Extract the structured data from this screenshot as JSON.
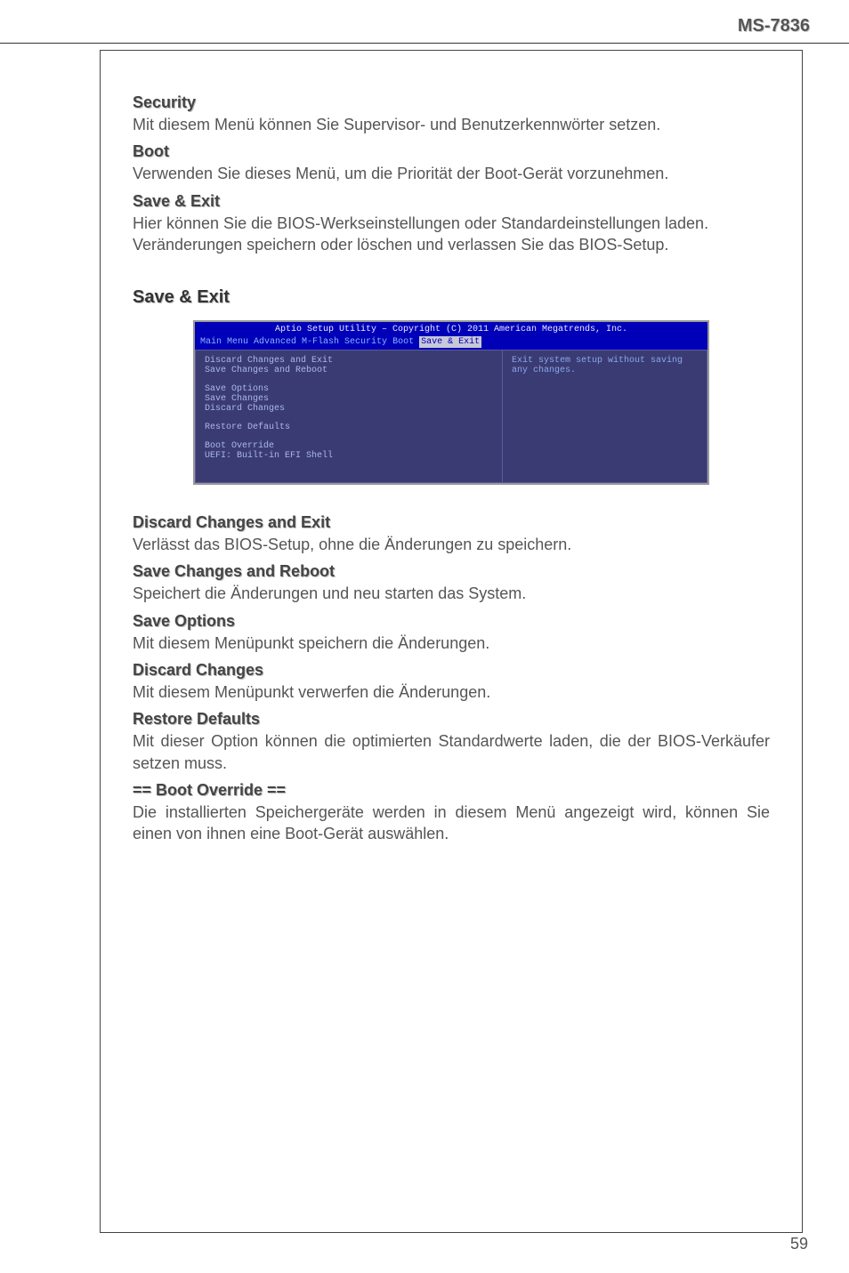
{
  "header": {
    "model": "MS-7836"
  },
  "intro_sections": [
    {
      "heading": "Security",
      "body": "Mit diesem Menü können Sie Supervisor- und Benutzerkennwörter setzen."
    },
    {
      "heading": "Boot",
      "body": "Verwenden Sie dieses Menü, um die Priorität der Boot-Gerät vorzunehmen."
    },
    {
      "heading": "Save & Exit",
      "body": "Hier können Sie die BIOS-Werkseinstellungen oder Standardeinstellungen laden. Veränderungen speichern oder löschen und verlassen Sie das BIOS-Setup."
    }
  ],
  "main_heading": "Save & Exit",
  "bios": {
    "title": "Aptio Setup Utility – Copyright (C) 2011 American Megatrends, Inc.",
    "tabs": [
      "Main Menu",
      "Advanced",
      "M-Flash",
      "Security",
      "Boot",
      "Save & Exit"
    ],
    "active_tab_index": 5,
    "left_groups": [
      [
        "Discard Changes and Exit",
        "Save Changes and Reboot"
      ],
      [
        "Save Options",
        "Save Changes",
        "Discard Changes"
      ],
      [
        "Restore Defaults"
      ],
      [
        "Boot Override",
        "UEFI: Built-in EFI Shell"
      ]
    ],
    "help_text": "Exit system setup without saving any changes."
  },
  "detail_sections": [
    {
      "heading": "Discard Changes and Exit",
      "body": "Verlässt das BIOS-Setup, ohne die Änderungen zu speichern."
    },
    {
      "heading": "Save Changes and Reboot",
      "body": "Speichert die Änderungen und neu starten das System."
    },
    {
      "heading": "Save Options",
      "body": "Mit diesem Menüpunkt speichern die Änderungen."
    },
    {
      "heading": "Discard Changes",
      "body": "Mit diesem Menüpunkt verwerfen die Änderungen."
    },
    {
      "heading": "Restore Defaults",
      "body": "Mit dieser Option können die optimierten Standardwerte laden, die der BIOS-Verkäufer setzen muss."
    },
    {
      "heading": "== Boot Override ==",
      "body": "Die installierten Speichergeräte werden in diesem Menü angezeigt wird, können Sie einen von ihnen eine Boot-Gerät auswählen."
    }
  ],
  "page_number": "59"
}
